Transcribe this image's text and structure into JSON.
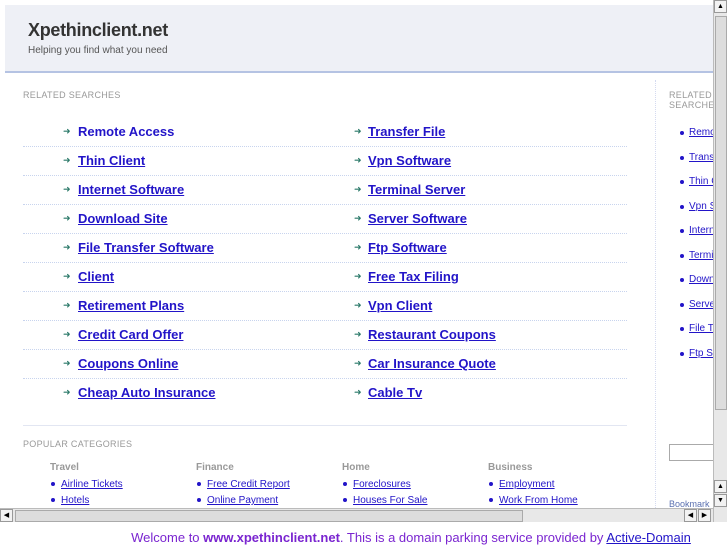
{
  "header": {
    "title": "Xpethinclient.net",
    "tagline": "Helping you find what you need"
  },
  "related": {
    "heading": "RELATED SEARCHES",
    "left": [
      "Remote Access",
      "Thin Client",
      "Internet Software",
      "Download Site",
      "File Transfer Software",
      "Client",
      "Retirement Plans",
      "Credit Card Offer",
      "Coupons Online",
      "Cheap Auto Insurance"
    ],
    "right": [
      "Transfer File",
      "Vpn Software",
      "Terminal Server",
      "Server Software",
      "Ftp Software",
      "Free Tax Filing",
      "Vpn Client",
      "Restaurant Coupons",
      "Car Insurance Quote",
      "Cable Tv"
    ]
  },
  "popular": {
    "heading": "POPULAR CATEGORIES",
    "categories": [
      {
        "name": "Travel",
        "items": [
          "Airline Tickets",
          "Hotels"
        ]
      },
      {
        "name": "Finance",
        "items": [
          "Free Credit Report",
          "Online Payment"
        ]
      },
      {
        "name": "Home",
        "items": [
          "Foreclosures",
          "Houses For Sale"
        ]
      },
      {
        "name": "Business",
        "items": [
          "Employment",
          "Work From Home"
        ]
      }
    ]
  },
  "sidebar": {
    "heading": "RELATED SEARCHES",
    "items": [
      "Remote Access",
      "Transfer File",
      "Thin Client",
      "Vpn Software",
      "Internet Software",
      "Terminal Server",
      "Download Site",
      "Server Software",
      "File Transfer Software",
      "Ftp Software"
    ],
    "bookmark": "Bookmark"
  },
  "footer": {
    "prefix": "Welcome to ",
    "domain": "www.xpethinclient.net",
    "middle": ". This is a domain parking service provided by ",
    "provider": "Active-Domain"
  }
}
